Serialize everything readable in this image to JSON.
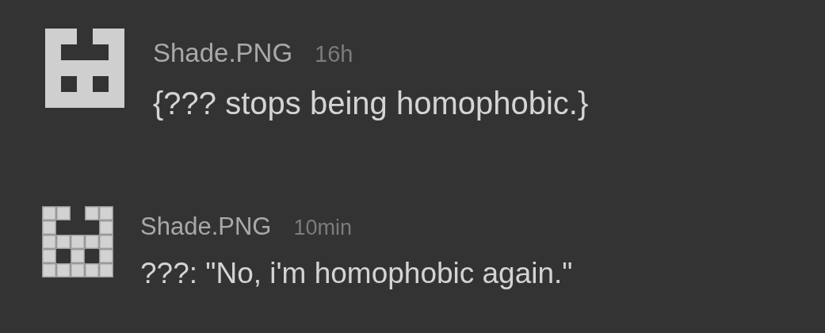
{
  "messages": [
    {
      "avatar": {
        "kind": "plain"
      },
      "author": "Shade.PNG",
      "time": "16h",
      "text": "{??? stops being homophobic.}"
    },
    {
      "avatar": {
        "kind": "tiled"
      },
      "author": "Shade.PNG",
      "time": "10min",
      "text": "???: \"No, i'm homophobic again.\""
    }
  ]
}
